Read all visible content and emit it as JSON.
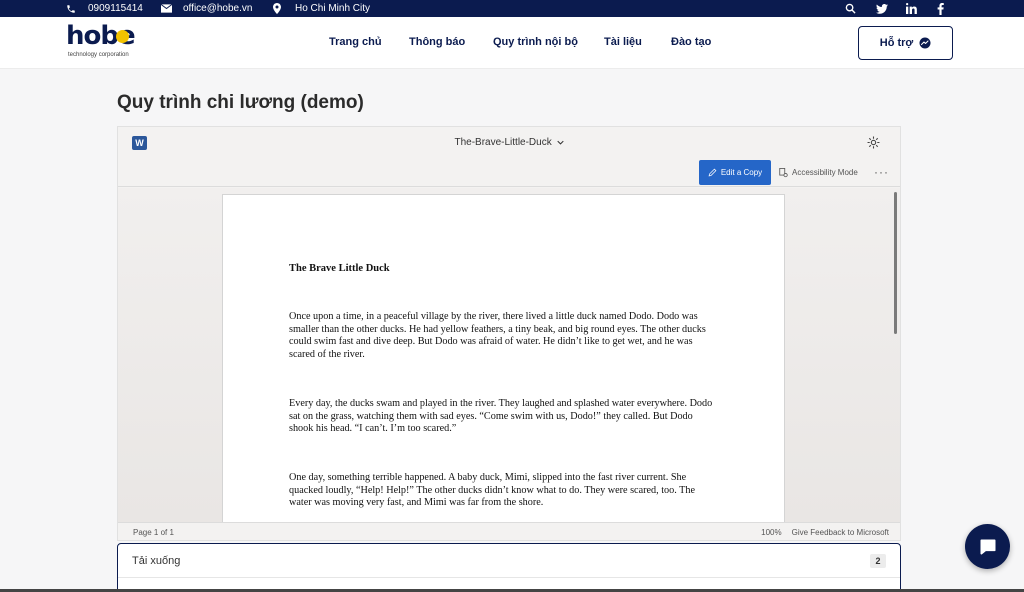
{
  "topbar": {
    "phone": "0909115414",
    "email": "office@hobe.vn",
    "location": "Ho Chi Minh City"
  },
  "header": {
    "logo_text": "hobe",
    "logo_tagline": "technology corporation",
    "nav": [
      "Trang chủ",
      "Thông báo",
      "Quy trình nội bộ",
      "Tài liệu",
      "Đào tạo"
    ],
    "support_label": "Hỗ trợ"
  },
  "page_title": "Quy trình chi lương (demo)",
  "viewer": {
    "app_icon_letter": "W",
    "doc_name": "The-Brave-Little-Duck",
    "edit_copy_label": "Edit a Copy",
    "accessibility_label": "Accessibility Mode",
    "more_label": "···",
    "doc_title": "The Brave Little Duck",
    "paragraphs": [
      "Once upon a time, in a peaceful village by the river, there lived a little duck named Dodo. Dodo was smaller than the other ducks. He had yellow feathers, a tiny beak, and big round eyes. The other ducks could swim fast and dive deep. But Dodo was afraid of water. He didn’t like to get wet, and he was scared of the river.",
      "Every day, the ducks swam and played in the river. They laughed and splashed water everywhere. Dodo sat on the grass, watching them with sad eyes. “Come swim with us, Dodo!” they called. But Dodo shook his head. “I can’t. I’m too scared.”",
      "One day, something terrible happened. A baby duck, Mimi, slipped into the fast river current. She quacked loudly, “Help! Help!” The other ducks didn’t know what to do. They were scared, too. The water was moving very fast, and Mimi was far from the shore."
    ],
    "page_indicator": "Page 1 of 1",
    "zoom": "100%",
    "feedback_label": "Give Feedback to Microsoft"
  },
  "downloads": {
    "label": "Tải xuống",
    "count": "2"
  },
  "colors": {
    "brand_navy": "#0b1b4f",
    "word_blue": "#2b579a",
    "edit_button_blue": "#2566c8",
    "logo_yellow": "#f2c200"
  }
}
